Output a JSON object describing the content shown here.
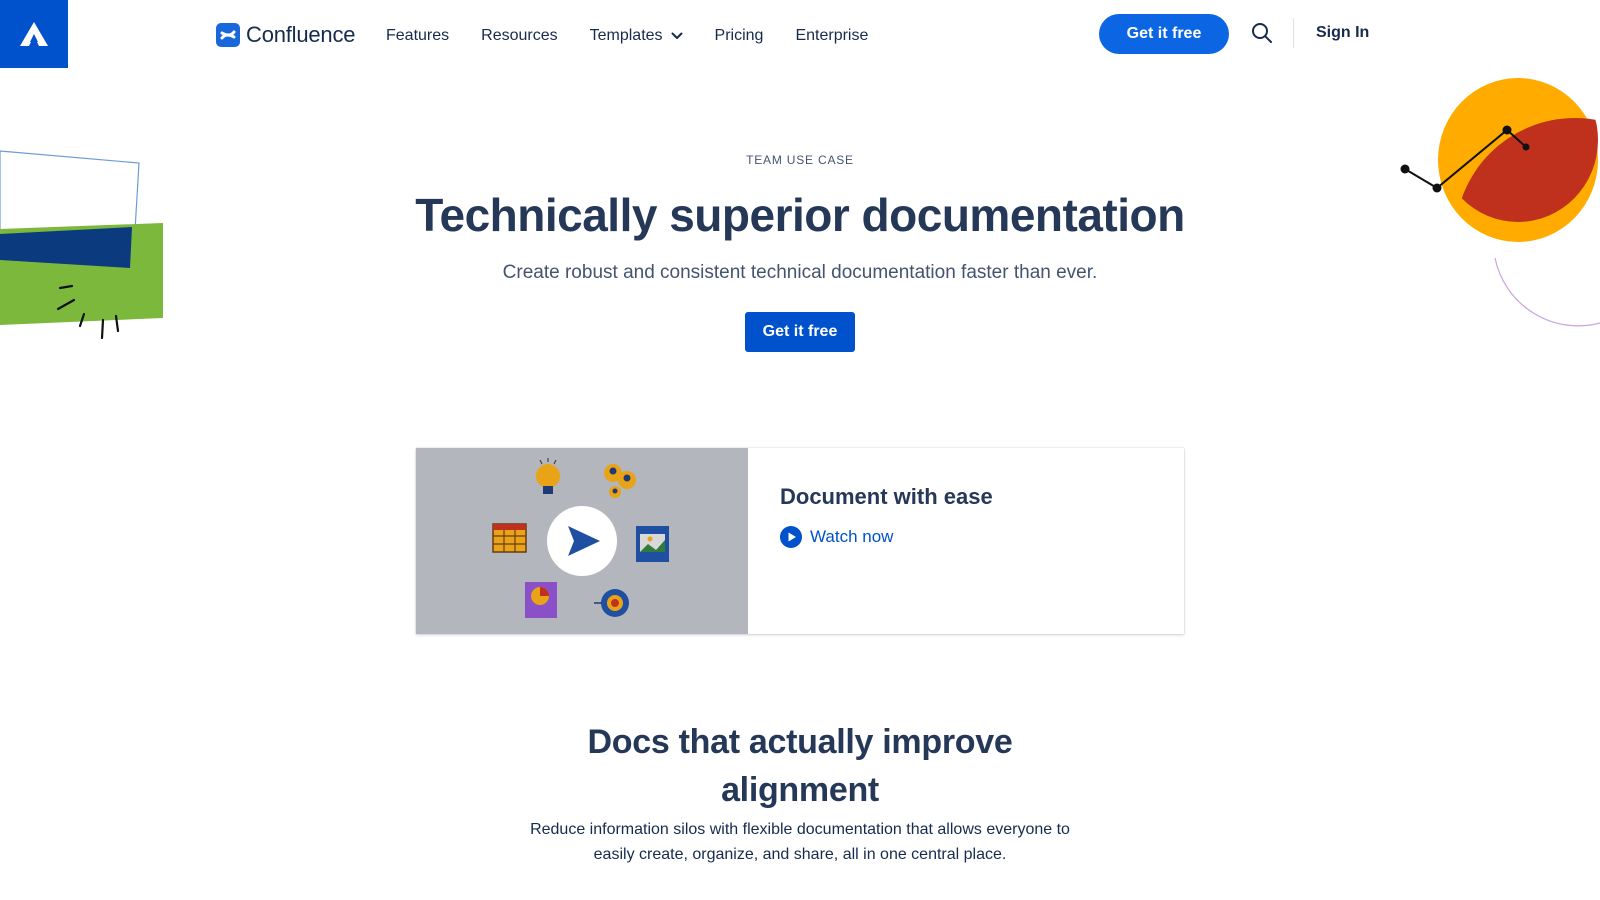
{
  "header": {
    "brand": "Confluence",
    "nav": [
      {
        "label": "Features"
      },
      {
        "label": "Resources"
      },
      {
        "label": "Templates"
      },
      {
        "label": "Pricing"
      },
      {
        "label": "Enterprise"
      }
    ],
    "cta_label": "Get it free",
    "signin_label": "Sign In",
    "icons": {
      "logo": "atlassian-logo-icon",
      "brand": "confluence-logo-icon",
      "search": "search-icon",
      "dropdown": "chevron-down-icon"
    }
  },
  "hero": {
    "eyebrow": "TEAM USE CASE",
    "title": "Technically superior documentation",
    "subtitle": "Create robust and consistent technical documentation faster than ever.",
    "cta_label": "Get it free"
  },
  "video_card": {
    "title": "Document with ease",
    "watch_label": "Watch now",
    "icons": {
      "play": "play-icon",
      "watch": "play-circle-icon"
    }
  },
  "section": {
    "title": "Docs that actually improve alignment",
    "subtitle": "Reduce information silos with flexible documentation that allows everyone to easily create, organize, and share, all in one central place."
  },
  "colors": {
    "primary": "#0052cc",
    "pill": "#0c66e4",
    "heading": "#253858",
    "text": "#172b4d",
    "deco_green": "#7bb83b",
    "deco_navy": "#0b3a7e",
    "deco_orange": "#ffab00",
    "deco_red": "#c0311d"
  }
}
